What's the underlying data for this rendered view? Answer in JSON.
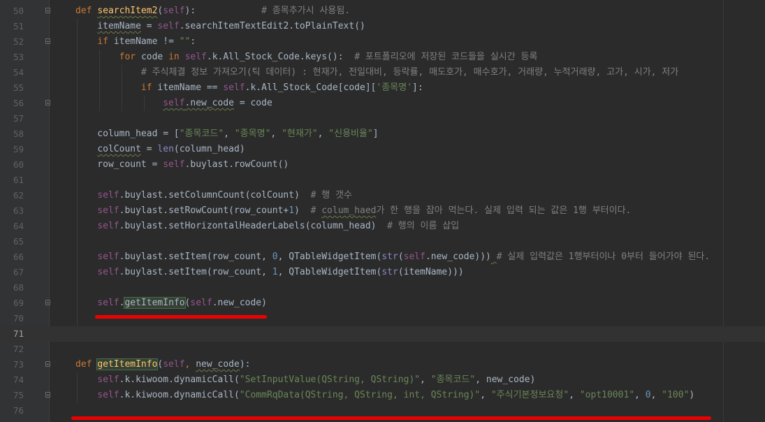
{
  "colors": {
    "background": "#2b2b2b",
    "gutter": "#313335",
    "keyword": "#cc7832",
    "function": "#ffc66d",
    "self": "#94558d",
    "string": "#6a8759",
    "number": "#6897bb",
    "comment": "#808080",
    "annotation_red": "#ee0000"
  },
  "lines": [
    {
      "n": "50",
      "segments": [
        [
          "kw",
          "def "
        ],
        [
          "fn wavy",
          "searchItem2"
        ],
        [
          "",
          "("
        ],
        [
          "sf",
          "self"
        ],
        [
          "",
          "):            "
        ],
        [
          "cm",
          "# 종목추가시 사용됨."
        ]
      ]
    },
    {
      "n": "51",
      "segments": [
        [
          "",
          "    "
        ],
        [
          "wavy",
          "itemName"
        ],
        [
          "",
          " = "
        ],
        [
          "sf",
          "self"
        ],
        [
          "",
          ".searchItemTextEdit2.toPlainText()"
        ]
      ]
    },
    {
      "n": "52",
      "segments": [
        [
          "",
          "    "
        ],
        [
          "kw",
          "if "
        ],
        [
          "",
          "itemName != "
        ],
        [
          "str",
          "\"\""
        ],
        [
          "",
          ":"
        ]
      ]
    },
    {
      "n": "53",
      "segments": [
        [
          "",
          "        "
        ],
        [
          "kw",
          "for "
        ],
        [
          "",
          "code "
        ],
        [
          "kw",
          "in "
        ],
        [
          "sf",
          "self"
        ],
        [
          "",
          ".k.All_Stock_Code.keys():  "
        ],
        [
          "cm",
          "# 포트폴리오에 저장된 코드들을 실시간 등록"
        ]
      ]
    },
    {
      "n": "54",
      "segments": [
        [
          "",
          "            "
        ],
        [
          "cm",
          "# 주식체결 정보 가져오기(틱 데이터) : 현재가, 전일대비, 등락률, 매도호가, 매수호가, 거래량, 누적거래량, 고가, 시가, 저가"
        ]
      ]
    },
    {
      "n": "55",
      "segments": [
        [
          "",
          "            "
        ],
        [
          "kw",
          "if "
        ],
        [
          "",
          "itemName == "
        ],
        [
          "sf",
          "self"
        ],
        [
          "",
          ".k.All_Stock_Code[code]["
        ],
        [
          "str",
          "'종목명'"
        ],
        [
          "",
          "]:"
        ]
      ]
    },
    {
      "n": "56",
      "segments": [
        [
          "",
          "                "
        ],
        [
          "sf wavy",
          "self"
        ],
        [
          "wavy",
          ".new_code"
        ],
        [
          "",
          " = code"
        ]
      ]
    },
    {
      "n": "57",
      "segments": []
    },
    {
      "n": "58",
      "segments": [
        [
          "",
          "    column_head = ["
        ],
        [
          "str",
          "\"종목코드\""
        ],
        [
          "",
          ", "
        ],
        [
          "str",
          "\"종목명\""
        ],
        [
          "",
          ", "
        ],
        [
          "str",
          "\"현재가\""
        ],
        [
          "",
          ", "
        ],
        [
          "str",
          "\"신용비율\""
        ],
        [
          "",
          "]"
        ]
      ]
    },
    {
      "n": "59",
      "segments": [
        [
          "",
          "    "
        ],
        [
          "wavy",
          "colCount"
        ],
        [
          "",
          " = "
        ],
        [
          "bi",
          "len"
        ],
        [
          "",
          "(column_head)"
        ]
      ]
    },
    {
      "n": "60",
      "segments": [
        [
          "",
          "    row_count = "
        ],
        [
          "sf",
          "self"
        ],
        [
          "",
          ".buylast.rowCount()"
        ]
      ]
    },
    {
      "n": "61",
      "segments": []
    },
    {
      "n": "62",
      "segments": [
        [
          "",
          "    "
        ],
        [
          "sf",
          "self"
        ],
        [
          "",
          ".buylast.setColumnCount(colCount)  "
        ],
        [
          "cm",
          "# 행 갯수"
        ]
      ]
    },
    {
      "n": "63",
      "segments": [
        [
          "",
          "    "
        ],
        [
          "sf",
          "self"
        ],
        [
          "",
          ".buylast.setRowCount(row_count+"
        ],
        [
          "num",
          "1"
        ],
        [
          "",
          ")  "
        ],
        [
          "cm",
          "# "
        ],
        [
          "cm wavy",
          "colum_haed"
        ],
        [
          "cm",
          "가 한 행을 잡아 먹는다. 실제 입력 되는 값은 1행 부터이다."
        ]
      ]
    },
    {
      "n": "64",
      "segments": [
        [
          "",
          "    "
        ],
        [
          "sf",
          "self"
        ],
        [
          "",
          ".buylast.setHorizontalHeaderLabels(column_head)  "
        ],
        [
          "cm",
          "# 행의 이름 삽입"
        ]
      ]
    },
    {
      "n": "65",
      "segments": []
    },
    {
      "n": "66",
      "segments": [
        [
          "",
          "    "
        ],
        [
          "sf",
          "self"
        ],
        [
          "",
          ".buylast.setItem(row_count, "
        ],
        [
          "num",
          "0"
        ],
        [
          "",
          ", QTableWidgetItem("
        ],
        [
          "bi",
          "str"
        ],
        [
          "",
          "("
        ],
        [
          "sf",
          "self"
        ],
        [
          "",
          ".new_code)))"
        ],
        [
          "wavy",
          " "
        ],
        [
          "cm",
          "# 실제 입력값은 1행부터이나 0부터 들어가야 된다."
        ]
      ]
    },
    {
      "n": "67",
      "segments": [
        [
          "",
          "    "
        ],
        [
          "sf",
          "self"
        ],
        [
          "",
          ".buylast.setItem(row_count, "
        ],
        [
          "num",
          "1"
        ],
        [
          "",
          ", QTableWidgetItem("
        ],
        [
          "bi",
          "str"
        ],
        [
          "",
          "(itemName)))"
        ]
      ]
    },
    {
      "n": "68",
      "segments": []
    },
    {
      "n": "69",
      "segments": [
        [
          "",
          "    "
        ],
        [
          "sf",
          "self"
        ],
        [
          "",
          "."
        ],
        [
          "hl",
          "getItemInfo"
        ],
        [
          "",
          "("
        ],
        [
          "sf",
          "self"
        ],
        [
          "",
          ".new_code)"
        ]
      ]
    },
    {
      "n": "70",
      "segments": []
    },
    {
      "n": "71",
      "segments": []
    },
    {
      "n": "72",
      "segments": []
    },
    {
      "n": "73",
      "segments": [
        [
          "kw",
          "def "
        ],
        [
          "fn hl",
          "getItemInfo"
        ],
        [
          "",
          "("
        ],
        [
          "sf",
          "self"
        ],
        [
          "kw",
          ", "
        ],
        [
          "wavy",
          "new_code"
        ],
        [
          "",
          "):"
        ]
      ]
    },
    {
      "n": "74",
      "segments": [
        [
          "",
          "    "
        ],
        [
          "sf",
          "self"
        ],
        [
          "",
          ".k.kiwoom.dynamicCall("
        ],
        [
          "str",
          "\"SetInputValue(QString, QString)\""
        ],
        [
          "",
          ", "
        ],
        [
          "str",
          "\"종목코드\""
        ],
        [
          "",
          ", new_code)"
        ]
      ]
    },
    {
      "n": "75",
      "segments": [
        [
          "",
          "    "
        ],
        [
          "sf",
          "self"
        ],
        [
          "",
          ".k.kiwoom.dynamicCall("
        ],
        [
          "str",
          "\"CommRqData(QString, QString, int, QString)\""
        ],
        [
          "",
          ", "
        ],
        [
          "str",
          "\"주식기본정보요청\""
        ],
        [
          "",
          ", "
        ],
        [
          "str",
          "\"opt10001\""
        ],
        [
          "",
          ", "
        ],
        [
          "num",
          "0"
        ],
        [
          "",
          ", "
        ],
        [
          "str",
          "\"100\""
        ],
        [
          "",
          ")"
        ]
      ]
    },
    {
      "n": "76",
      "segments": []
    }
  ]
}
